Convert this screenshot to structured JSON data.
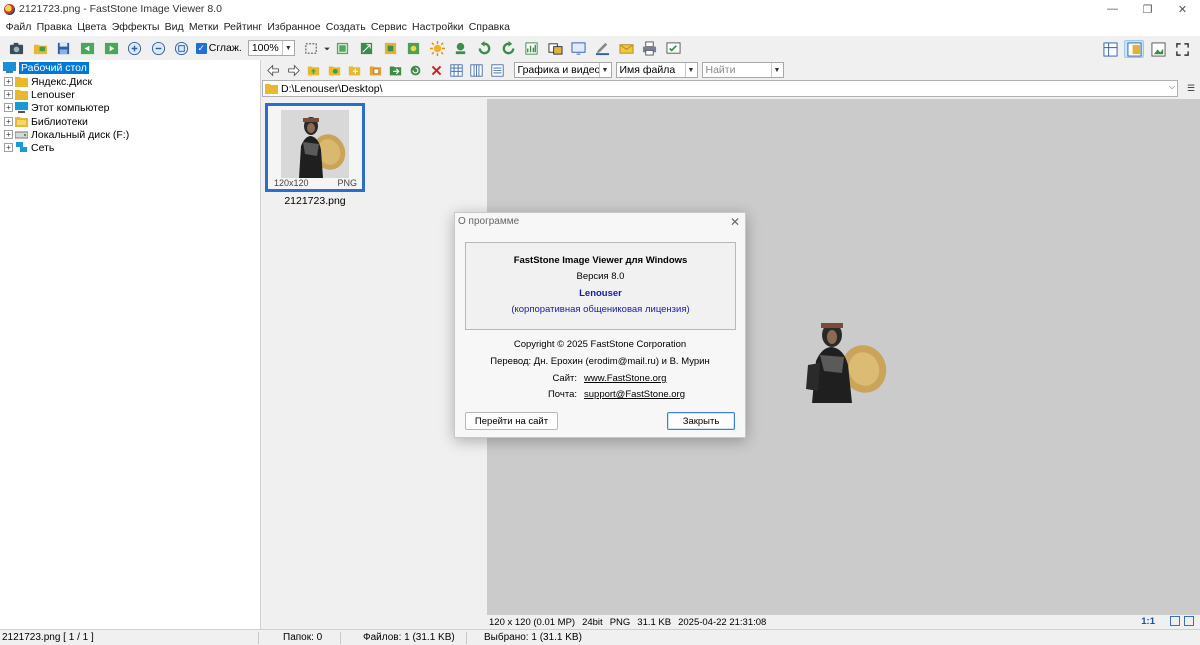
{
  "window": {
    "title": "2121723.png  -  FastStone Image Viewer 8.0",
    "minimize": "—",
    "maximize": "❐",
    "close": "✕"
  },
  "menu": [
    "Файл",
    "Правка",
    "Цвета",
    "Эффекты",
    "Вид",
    "Метки",
    "Рейтинг",
    "Избранное",
    "Создать",
    "Сервис",
    "Настройки",
    "Справка"
  ],
  "toolbar": {
    "smooth_label": "Сглаж.",
    "zoom_value": "100%"
  },
  "navbar": {
    "filter_value": "Графика и видео",
    "sort_value": "Имя файла",
    "search_placeholder": "Найти",
    "path": "D:\\Lenouser\\Desktop\\"
  },
  "tree": {
    "items": [
      {
        "label": "Рабочий стол",
        "selected": true
      },
      {
        "label": "Яндекс.Диск"
      },
      {
        "label": "Lenouser"
      },
      {
        "label": "Этот компьютер"
      },
      {
        "label": "Библиотеки"
      },
      {
        "label": "Локальный диск (F:)"
      },
      {
        "label": "Сеть"
      }
    ]
  },
  "thumbnail": {
    "dims": "120x120",
    "format": "PNG",
    "filename": "2121723.png"
  },
  "preview_info": {
    "size": "120 x 120 (0.01 MP)",
    "depth": "24bit",
    "format": "PNG",
    "filesize": "31.1 KB",
    "date": "2025-04-22 21:31:08",
    "zoom": "1:1"
  },
  "statusbar": {
    "file": "2121723.png [ 1 / 1 ]",
    "folders": "Папок: 0",
    "files": "Файлов: 1 (31.1 KB)",
    "selected": "Выбрано: 1 (31.1 KB)"
  },
  "dialog": {
    "title": "О программе",
    "product": "FastStone Image Viewer для Windows",
    "version": "Версия 8.0",
    "user": "Lenouser",
    "license": "(корпоративная общениковая лицензия)",
    "copyright": "Copyright © 2025 FastStone Corporation",
    "translation": "Перевод: Дн. Ерохин (erodim@mail.ru) и В. Мурин",
    "site_label": "Сайт:",
    "site_value": "www.FastStone.org",
    "mail_label": "Почта:",
    "mail_value": "support@FastStone.org",
    "visit_button": "Перейти на сайт",
    "close_button": "Закрыть"
  },
  "colors": {
    "accent": "#0078d7",
    "thumb_border": "#2a6fce",
    "preview_bg": "#cbcbcb",
    "link_blue": "#1a1aa8"
  }
}
